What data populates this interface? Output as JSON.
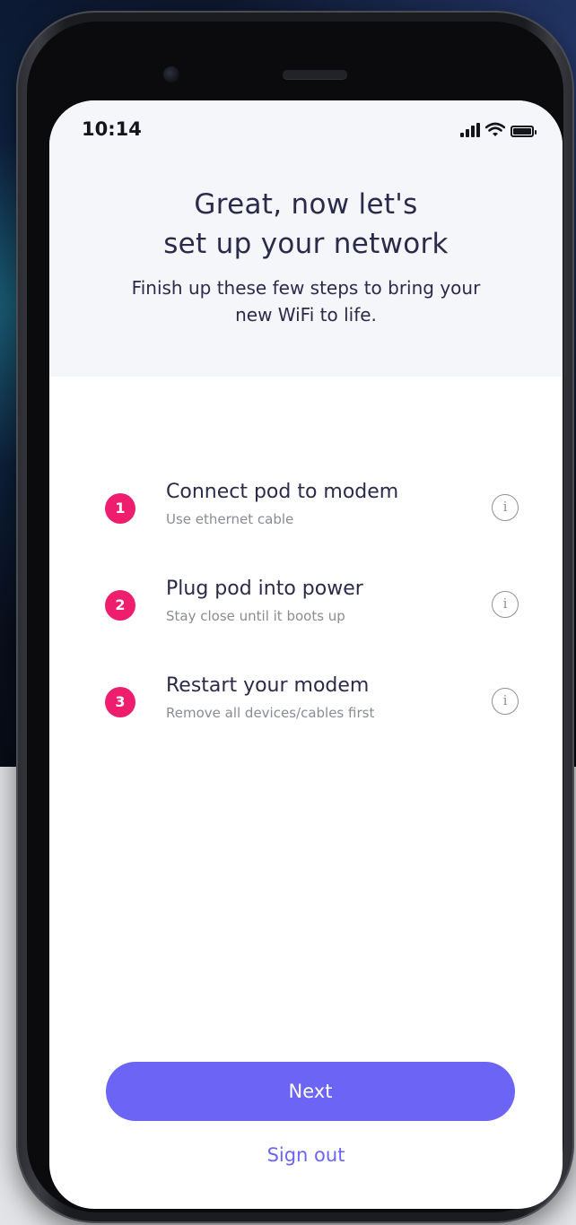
{
  "status_bar": {
    "time": "10:14",
    "icons": [
      "signal-icon",
      "wifi-icon",
      "battery-icon"
    ]
  },
  "header": {
    "title_line1": "Great, now let's",
    "title_line2": "set up your network",
    "subtitle_line1": "Finish up these few steps to bring your",
    "subtitle_line2": "new WiFi to life."
  },
  "steps": [
    {
      "number": "1",
      "title": "Connect pod to modem",
      "description": "Use ethernet cable",
      "info_icon": "i"
    },
    {
      "number": "2",
      "title": "Plug pod into power",
      "description": "Stay close until it boots up",
      "info_icon": "i"
    },
    {
      "number": "3",
      "title": "Restart your modem",
      "description": "Remove all devices/cables first",
      "info_icon": "i"
    }
  ],
  "actions": {
    "next_label": "Next",
    "sign_out_label": "Sign out"
  },
  "colors": {
    "accent": "#6c64f4",
    "badge": "#ef1d6e",
    "title_text": "#2c2a4a",
    "secondary_text": "#8a8c94",
    "header_background": "#f5f6f9"
  }
}
